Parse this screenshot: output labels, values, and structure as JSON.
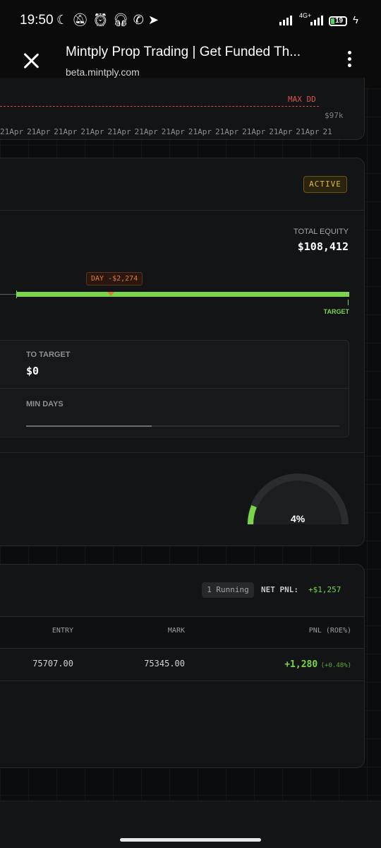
{
  "status_bar": {
    "time": "19:50",
    "network": "4G+",
    "battery": "19"
  },
  "browser": {
    "title": "Mintply Prop Trading | Get Funded Th...",
    "url": "beta.mintply.com"
  },
  "equity_chart_card": {
    "max_dd_label": "MAX DD",
    "level_label": "$97k",
    "x_ticks": [
      "21Apr",
      "21Apr",
      "21Apr",
      "21Apr",
      "21Apr",
      "21Apr",
      "21Apr",
      "21Apr",
      "21Apr",
      "21Apr",
      "21Apr",
      "21Apr",
      "21"
    ]
  },
  "challenge_card": {
    "status": "ACTIVE",
    "total_equity_label": "TOTAL EQUITY",
    "total_equity_value": "$108,412",
    "day_marker_label": "DAY -$2,274",
    "target_label": "TARGET",
    "to_target_label": "TO TARGET",
    "to_target_value": "$0",
    "min_days_label": "MIN DAYS",
    "min_days_progress": 0.4
  },
  "gauge_card": {
    "value_text": "4%",
    "value": 0.04
  },
  "positions_card": {
    "running_badge": "1 Running",
    "net_pnl_label": "NET PNL:",
    "net_pnl_value": "+$1,257",
    "columns": [
      "ENTRY",
      "MARK",
      "PNL (ROE%)"
    ],
    "rows": [
      {
        "entry": "75707.00",
        "mark": "75345.00",
        "pnl": "+1,280",
        "roe": "(+0.48%)"
      }
    ]
  },
  "colors": {
    "accent_green": "#7bd54b",
    "danger_red": "#e0534a",
    "warning_amber": "#e6b83a"
  }
}
